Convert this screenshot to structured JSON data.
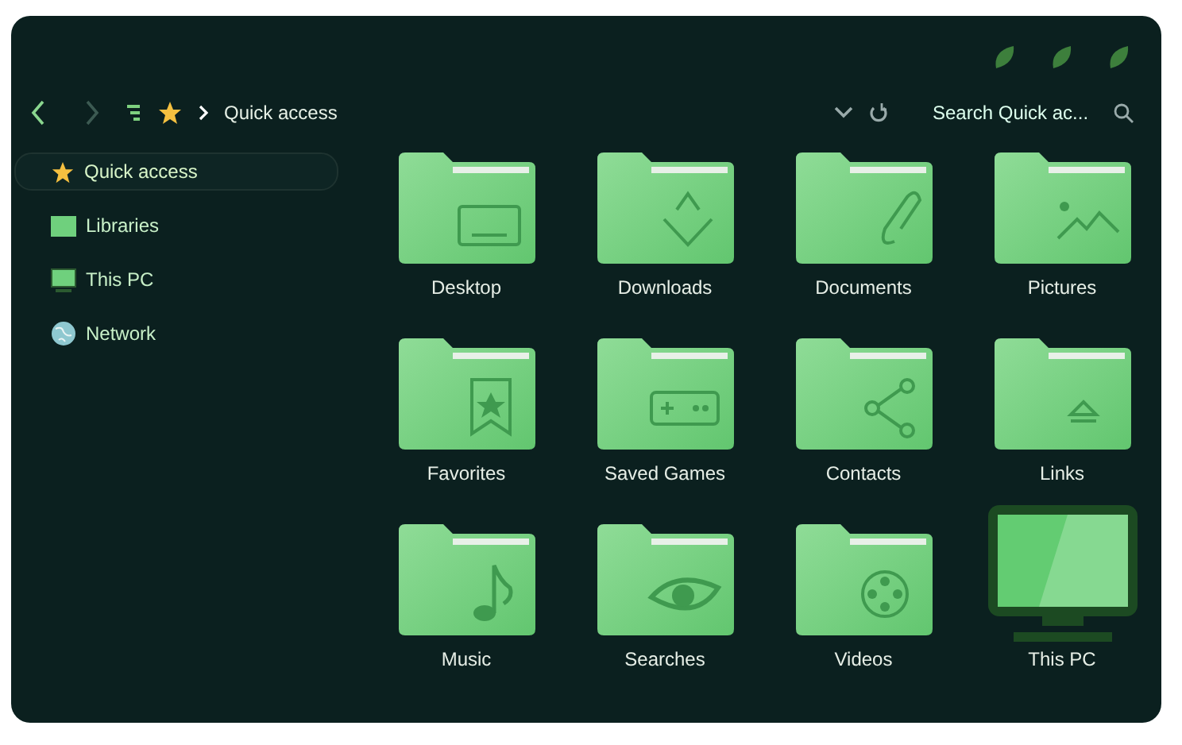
{
  "toolbar": {
    "breadcrumb": "Quick access",
    "search": {
      "placeholder": "Search Quick ac..."
    }
  },
  "sidebar": {
    "items": [
      {
        "label": "Quick access",
        "selected": true
      },
      {
        "label": "Libraries",
        "selected": false
      },
      {
        "label": "This PC",
        "selected": false
      },
      {
        "label": "Network",
        "selected": false
      }
    ]
  },
  "items": [
    {
      "label": "Desktop",
      "kind": "folder"
    },
    {
      "label": "Downloads",
      "kind": "folder"
    },
    {
      "label": "Documents",
      "kind": "folder"
    },
    {
      "label": "Pictures",
      "kind": "folder"
    },
    {
      "label": "Favorites",
      "kind": "folder"
    },
    {
      "label": "Saved Games",
      "kind": "folder"
    },
    {
      "label": "Contacts",
      "kind": "folder"
    },
    {
      "label": "Links",
      "kind": "folder"
    },
    {
      "label": "Music",
      "kind": "folder"
    },
    {
      "label": "Searches",
      "kind": "folder"
    },
    {
      "label": "Videos",
      "kind": "folder"
    },
    {
      "label": "This PC",
      "kind": "computer"
    }
  ]
}
